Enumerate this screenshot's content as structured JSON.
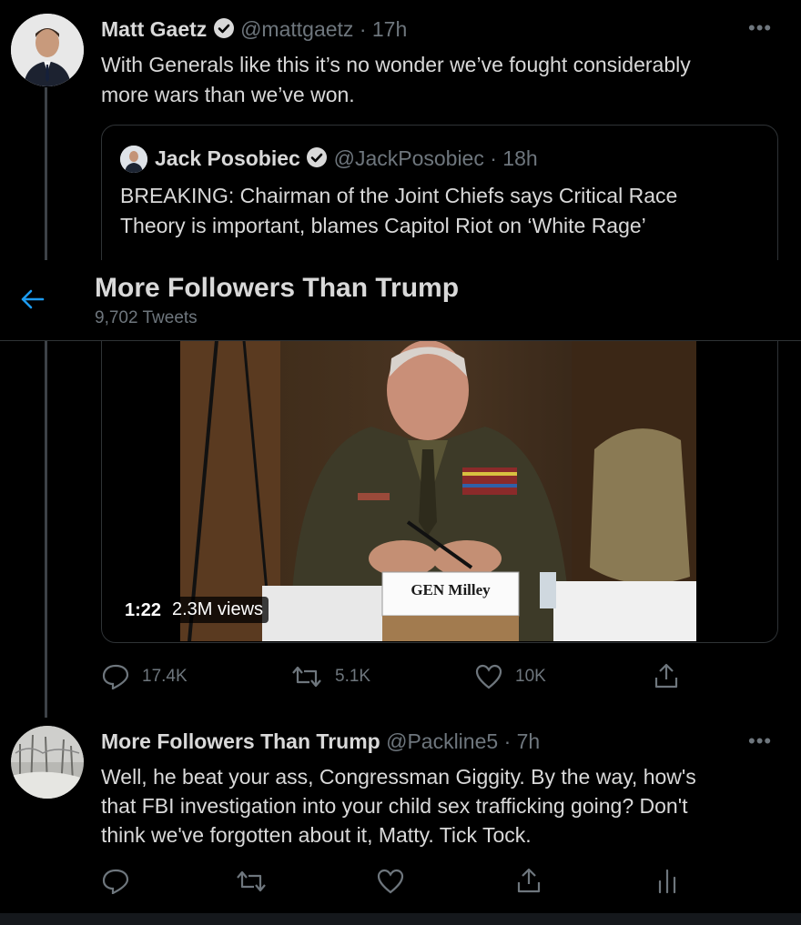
{
  "tweet1": {
    "author": "Matt Gaetz",
    "handle": "@mattgaetz",
    "time": "· 17h",
    "text_line1": "With Generals like this it’s no wonder we’ve fought considerably",
    "text_line2": "more wars than we’ve won.",
    "more_icon": "more-dots-icon"
  },
  "quote": {
    "author": "Jack Posobiec",
    "handle": "@JackPosobiec",
    "time": "· 18h",
    "text_line1": "BREAKING: Chairman of the Joint Chiefs says Critical Race",
    "text_line2": "Theory is important, blames Capitol Riot on ‘White Rage’",
    "video": {
      "duration": "1:22",
      "views": "2.3M views",
      "nameplate": "GEN Milley"
    }
  },
  "header": {
    "title": "More Followers Than Trump",
    "subtitle": "9,702 Tweets",
    "back_icon": "back-arrow-icon"
  },
  "tweet1_actions": {
    "replies": "17.4K",
    "retweets": "5.1K",
    "likes": "10K"
  },
  "tweet2": {
    "author": "More Followers Than Trump",
    "handle": "@Packline5",
    "time": "· 7h",
    "text_line1": "Well, he beat your ass, Congressman Giggity.  By the way, how's",
    "text_line2": "that FBI investigation into your child sex trafficking going? Don't",
    "text_line3": "think we've forgotten about it, Matty.  Tick Tock."
  },
  "colors": {
    "background": "#000000",
    "accent": "#1d9bf0",
    "muted": "#6e767d",
    "text": "#d9d9d9",
    "border": "#2f3336"
  }
}
